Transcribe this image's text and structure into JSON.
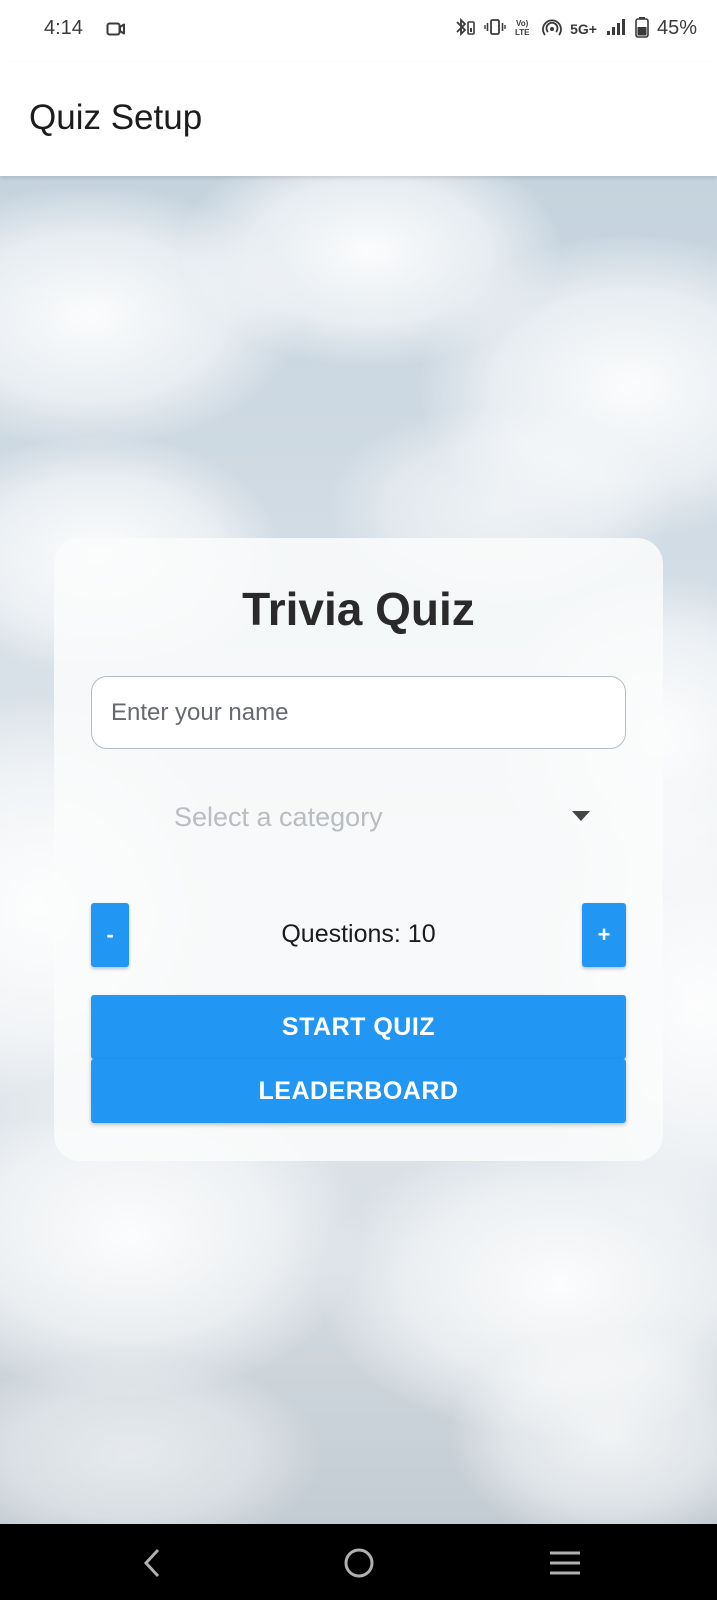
{
  "status_bar": {
    "time": "4:14",
    "network_label": "5G+",
    "battery_percent": "45%",
    "icons": [
      "video-camera-icon",
      "bluetooth-icon",
      "vibrate-icon",
      "volte-icon",
      "hotspot-icon",
      "signal-icon",
      "battery-icon"
    ]
  },
  "app_bar": {
    "title": "Quiz Setup"
  },
  "card": {
    "title": "Trivia Quiz",
    "name_input": {
      "placeholder": "Enter your name",
      "value": ""
    },
    "category_select": {
      "placeholder": "Select a category",
      "selected": ""
    },
    "stepper": {
      "minus_label": "-",
      "plus_label": "+",
      "questions_text": "Questions: 10"
    },
    "start_button": "START QUIZ",
    "leaderboard_button": "LEADERBOARD"
  },
  "colors": {
    "primary": "#2196f3",
    "card_background": "#f7f8fa",
    "nav_bar": "#000000"
  },
  "nav_bar": {
    "icons": [
      "back-icon",
      "home-icon",
      "recents-icon"
    ]
  }
}
